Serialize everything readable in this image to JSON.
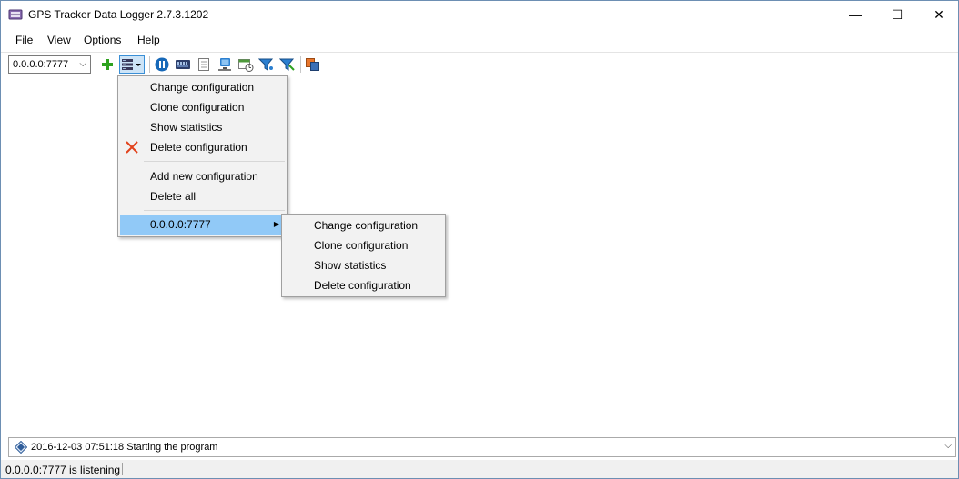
{
  "window": {
    "title": "GPS Tracker Data Logger 2.7.3.1202",
    "minimize_glyph": "—",
    "maximize_glyph": "☐",
    "close_glyph": "✕"
  },
  "menubar": {
    "file": {
      "accel": "F",
      "rest": "ile"
    },
    "view": {
      "accel": "V",
      "rest": "iew"
    },
    "options": {
      "accel": "O",
      "rest": "ptions"
    },
    "help": {
      "accel": "H",
      "rest": "elp"
    }
  },
  "toolbar": {
    "config_combo": {
      "value": "0.0.0.0:7777",
      "arrow": "⌵"
    },
    "buttons": [
      {
        "icon": "add-icon"
      },
      {
        "icon": "configurations-menu-icon"
      },
      {
        "icon": "pause-icon"
      },
      {
        "icon": "port-monitor-icon"
      },
      {
        "icon": "document-icon"
      },
      {
        "icon": "computer-icon"
      },
      {
        "icon": "schedule-icon"
      },
      {
        "icon": "filter-icon"
      },
      {
        "icon": "filter-edit-icon"
      },
      {
        "icon": "copy-icon"
      }
    ]
  },
  "context_menu": {
    "items": [
      {
        "label": "Change configuration"
      },
      {
        "label": "Clone configuration"
      },
      {
        "label": "Show statistics"
      },
      {
        "label": "Delete configuration",
        "icon": "delete-icon"
      },
      {
        "label": "Add new configuration"
      },
      {
        "label": "Delete all"
      },
      {
        "label": "0.0.0.0:7777",
        "arrow": "▶"
      }
    ]
  },
  "submenu": {
    "items": [
      {
        "label": "Change configuration"
      },
      {
        "label": "Clone configuration"
      },
      {
        "label": "Show statistics"
      },
      {
        "label": "Delete configuration"
      }
    ]
  },
  "log": {
    "message": "2016-12-03 07:51:18 Starting the program",
    "arrow": "⌵"
  },
  "status": {
    "text": "0.0.0.0:7777 is listening"
  },
  "colors": {
    "highlight": "#91c9f7",
    "delete_red": "#e2421c",
    "add_green": "#2ea21f",
    "pause_blue": "#1668b8"
  }
}
